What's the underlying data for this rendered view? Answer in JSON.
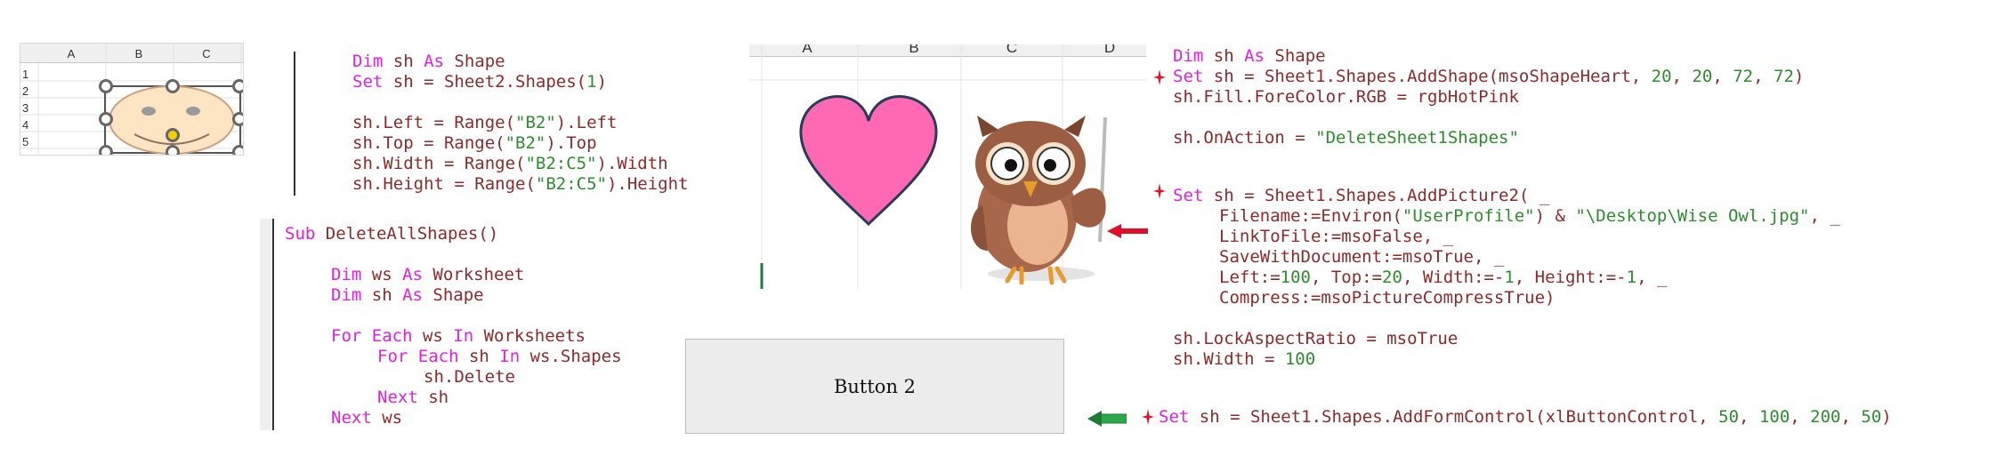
{
  "excel_thumb1": {
    "columns": [
      "A",
      "B",
      "C"
    ],
    "rows": [
      "1",
      "2",
      "3",
      "4",
      "5"
    ]
  },
  "excel_thumb2": {
    "columns": [
      "A",
      "B",
      "C",
      "D"
    ]
  },
  "colors": {
    "keyword": "#e020e0",
    "identifier": "#8b2a2a",
    "string": "#2e8b2e",
    "heart": "#ff69b4",
    "face": "#fde4c3",
    "marker_red": "#e0102a",
    "marker_green": "#2aa84a"
  },
  "code_block1": {
    "l1": {
      "k1": "Dim",
      "t1": " sh ",
      "k2": "As",
      "t2": " Shape"
    },
    "l2": {
      "k1": "Set",
      "t1": " sh = Sheet2.Shapes(",
      "n1": "1",
      "t2": ")"
    },
    "l3": {
      "t1": "sh.Left = Range(",
      "s1": "\"B2\"",
      "t2": ").Left"
    },
    "l4": {
      "t1": "sh.Top = Range(",
      "s1": "\"B2\"",
      "t2": ").Top"
    },
    "l5": {
      "t1": "sh.Width = Range(",
      "s1": "\"B2:C5\"",
      "t2": ").Width"
    },
    "l6": {
      "t1": "sh.Height = Range(",
      "s1": "\"B2:C5\"",
      "t2": ").Height"
    }
  },
  "code_block2": {
    "l1": {
      "k1": "Sub",
      "t1": " DeleteAllShapes()"
    },
    "l2": {
      "k1": "Dim",
      "t1": " ws ",
      "k2": "As",
      "t2": " Worksheet"
    },
    "l3": {
      "k1": "Dim",
      "t1": " sh ",
      "k2": "As",
      "t2": " Shape"
    },
    "l4": {
      "k1": "For Each",
      "t1": " ws ",
      "k2": "In",
      "t2": " Worksheets"
    },
    "l5": {
      "k1": "For Each",
      "t1": " sh ",
      "k2": "In",
      "t2": " ws.Shapes"
    },
    "l6": {
      "t1": "sh.Delete"
    },
    "l7": {
      "k1": "Next",
      "t1": " sh"
    },
    "l8": {
      "k1": "Next",
      "t1": " ws"
    }
  },
  "code_block3": {
    "l1": {
      "k1": "Dim",
      "t1": " sh ",
      "k2": "As",
      "t2": " Shape"
    },
    "l2": {
      "k1": "Set",
      "t1": " sh = Sheet1.Shapes.AddShape(msoShapeHeart, ",
      "n1": "20",
      "t2": ", ",
      "n2": "20",
      "t3": ", ",
      "n3": "72",
      "t4": ", ",
      "n4": "72",
      "t5": ")"
    },
    "l3": {
      "t1": "sh.Fill.ForeColor.RGB = rgbHotPink"
    },
    "l4": {
      "t1": "sh.OnAction = ",
      "s1": "\"DeleteSheet1Shapes\""
    },
    "l5": {
      "k1": "Set",
      "t1": " sh = Sheet1.Shapes.AddPicture2( _"
    },
    "l6": {
      "t1": "Filename:=Environ(",
      "s1": "\"UserProfile\"",
      "t2": ") & ",
      "s2": "\"\\Desktop\\Wise Owl.jpg\"",
      "t3": ", _"
    },
    "l7": {
      "t1": "LinkToFile:=msoFalse, _"
    },
    "l8": {
      "t1": "SaveWithDocument:=msoTrue, _"
    },
    "l9": {
      "t1": "Left:=",
      "n1": "100",
      "t2": ", Top:=",
      "n2": "20",
      "t3": ", Width:=-",
      "n3": "1",
      "t4": ", Height:=-",
      "n4": "1",
      "t5": ", _"
    },
    "l10": {
      "t1": "Compress:=msoPictureCompressTrue)"
    },
    "l11": {
      "t1": "sh.LockAspectRatio = msoTrue"
    },
    "l12": {
      "t1": "sh.Width = ",
      "n1": "100"
    },
    "l13": {
      "k1": "Set",
      "t1": " sh = Sheet1.Shapes.AddFormControl(xlButtonControl, ",
      "n1": "50",
      "t2": ", ",
      "n2": "100",
      "t3": ", ",
      "n3": "200",
      "t4": ", ",
      "n4": "50",
      "t5": ")"
    }
  },
  "button2": {
    "label": "Button 2"
  },
  "icons": [
    "smiley-face-shape",
    "heart-shape",
    "owl-picture",
    "red-arrow-icon",
    "green-arrow-icon",
    "red-star-marker-icon"
  ]
}
